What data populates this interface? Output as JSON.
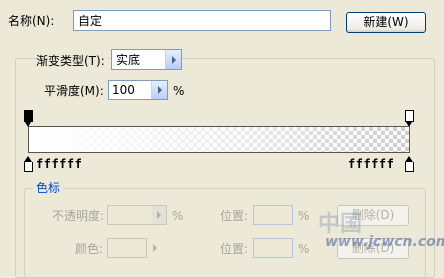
{
  "name_row": {
    "label": "名称(N):",
    "value": "自定",
    "new_button": "新建(W)"
  },
  "gradient_type": {
    "label": "渐变类型(T):",
    "value": "实底"
  },
  "smoothness": {
    "label": "平滑度(M):",
    "value": "100",
    "unit": "%"
  },
  "gradient_bar": {
    "left_color_label": "ffffff",
    "right_color_label": "ffffff"
  },
  "stops_group": {
    "title": "色标",
    "opacity_label": "不透明度:",
    "opacity_unit": "%",
    "position_label_1": "位置:",
    "position_unit_1": "%",
    "delete_button": "删除(D)",
    "color_label": "颜色:",
    "position_label_2": "位置:",
    "position_unit_2": "%",
    "delete_button_2": "删除(D)"
  },
  "watermark": {
    "text_1": "中国",
    "text_2": "www.jcwcn.com"
  },
  "colors": {
    "accent": "#0046d5",
    "field_border": "#7f9db9",
    "bg": "#ece9d8"
  }
}
